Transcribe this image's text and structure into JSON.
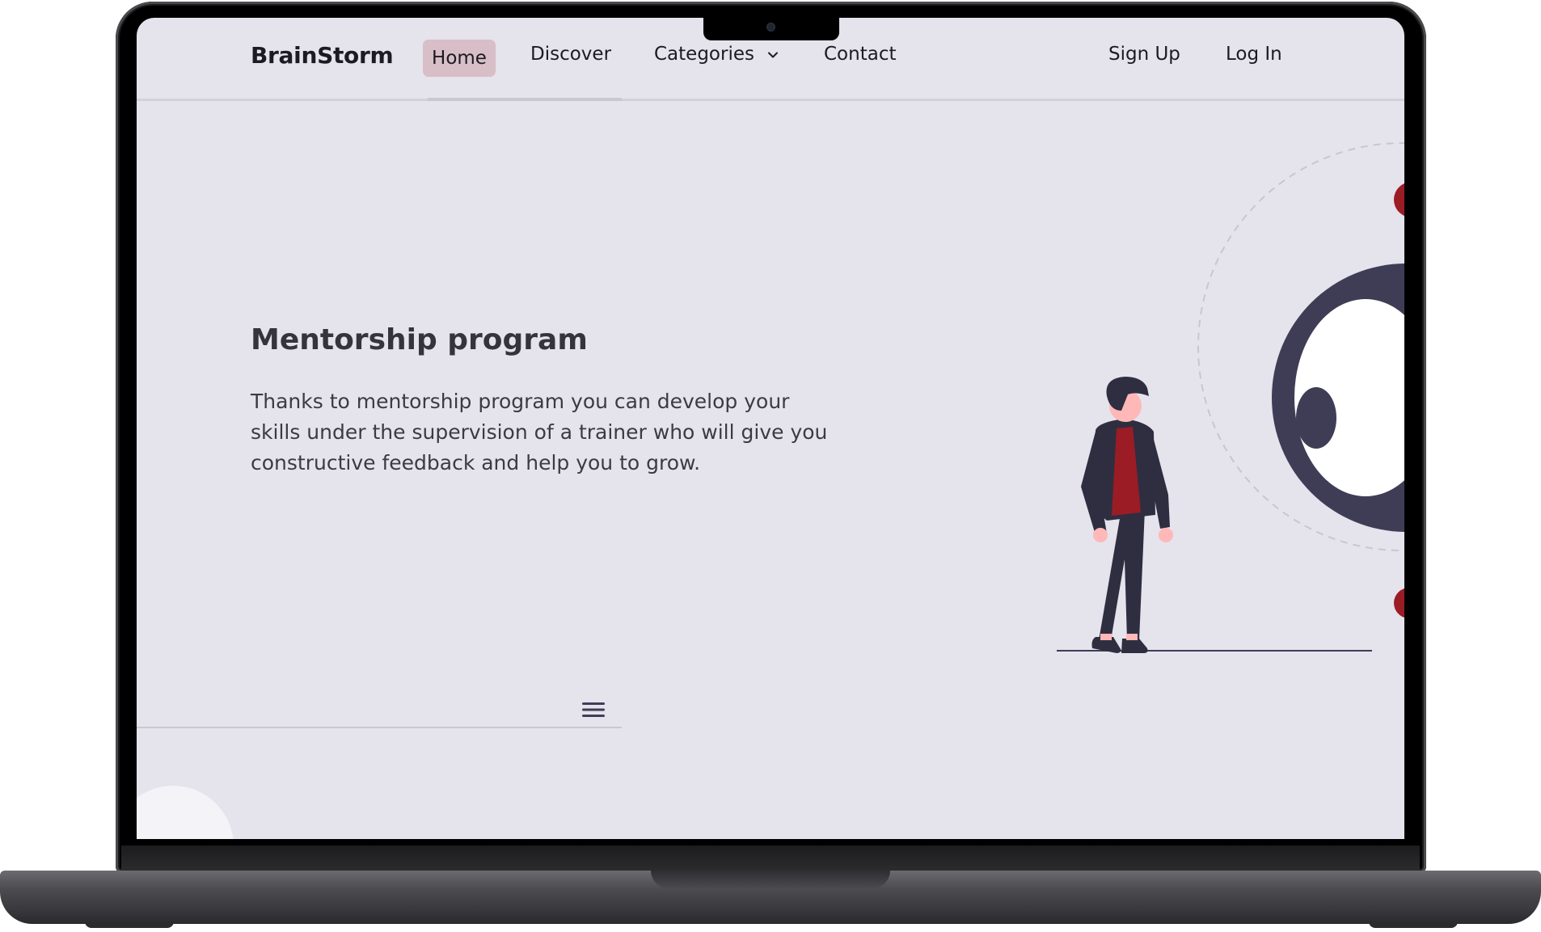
{
  "navbar": {
    "brand": "BrainStorm",
    "links": [
      {
        "label": "Home"
      },
      {
        "label": "Discover"
      },
      {
        "label": "Categories"
      },
      {
        "label": "Contact"
      }
    ],
    "sign_up": "Sign Up",
    "log_in": "Log In"
  },
  "hero": {
    "title": "Mentorship program",
    "text": "Thanks to mentorship program you can develop your skills under the supervision of a trainer who will give you constructive feedback and help you to grow."
  },
  "icons": {
    "categories_toggle": "chevron-down-icon",
    "menu": "hamburger-menu-icon"
  },
  "colors": {
    "background": "#e5e3ec",
    "accent_highlight": "#d8bec7",
    "accent_red": "#9b1c25",
    "dark_navy": "#3f3d56",
    "text_dark": "#1c1b22"
  }
}
